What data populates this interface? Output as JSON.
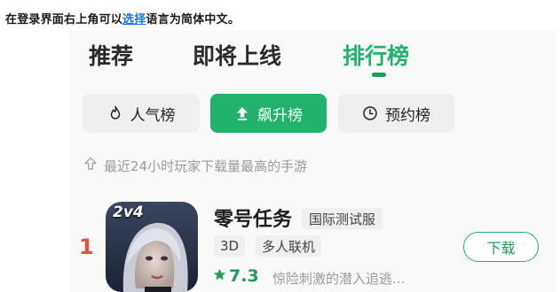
{
  "note": {
    "before": "在登录界面右上角可以",
    "link": "选择",
    "after": "语言为简体中文。"
  },
  "top_tabs": [
    {
      "label": "推荐",
      "active": false
    },
    {
      "label": "即将上线",
      "active": false
    },
    {
      "label": "排行榜",
      "active": true
    }
  ],
  "chips": [
    {
      "label": "人气榜",
      "icon": "flame-icon",
      "active": false
    },
    {
      "label": "飙升榜",
      "icon": "arrow-up-icon",
      "active": true
    },
    {
      "label": "预约榜",
      "icon": "clock-icon",
      "active": false
    }
  ],
  "hint": "最近24小时玩家下载量最高的手游",
  "game": {
    "rank": "1",
    "icon_text": "2v4",
    "name": "零号任务",
    "badge": "国际测试服",
    "tags": [
      "3D",
      "多人联机"
    ],
    "rating": "7.3",
    "description": "惊险刺激的潜入追逃...",
    "download_label": "下载"
  },
  "colors": {
    "accent": "#21b26c",
    "rank": "#e0533c",
    "link": "#1a73e8"
  }
}
